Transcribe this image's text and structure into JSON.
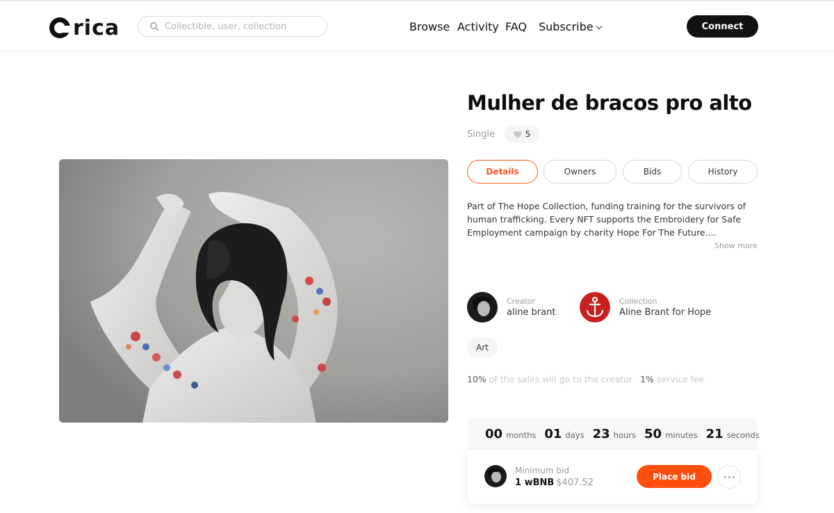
{
  "header": {
    "logo_text": "rica",
    "search_placeholder": "Collectible, user, collection",
    "nav": [
      "Browse",
      "Activity",
      "FAQ",
      "Subscribe"
    ],
    "connect_label": "Connect"
  },
  "item": {
    "title": "Mulher de bracos pro alto",
    "edition": "Single",
    "likes": "5",
    "tabs": [
      "Details",
      "Owners",
      "Bids",
      "History"
    ],
    "active_tab": "Details",
    "description": "Part of The Hope Collection, funding training for the survivors of human trafficking. Every NFT supports the Embroidery for Safe Employment campaign by charity Hope For The Future....",
    "show_more": "Show more",
    "creator": {
      "role": "Creator",
      "name": "aline brant"
    },
    "collection": {
      "role": "Collection",
      "name": "Aline Brant for Hope"
    },
    "tag": "Art",
    "royalty": {
      "value": "10%",
      "text": "of the sales will go to the creator"
    },
    "service_fee": {
      "value": "1%",
      "text": "service fee"
    }
  },
  "auction": {
    "countdown": [
      {
        "value": "00",
        "unit": "months"
      },
      {
        "value": "01",
        "unit": "days"
      },
      {
        "value": "23",
        "unit": "hours"
      },
      {
        "value": "50",
        "unit": "minutes"
      },
      {
        "value": "21",
        "unit": "seconds"
      }
    ],
    "min_bid_label": "Minimum bid",
    "min_bid_value": "1 wBNB",
    "min_bid_usd": "$407.52",
    "place_bid_label": "Place bid"
  },
  "colors": {
    "accent": "#ff4f0f",
    "dark": "#111111"
  }
}
